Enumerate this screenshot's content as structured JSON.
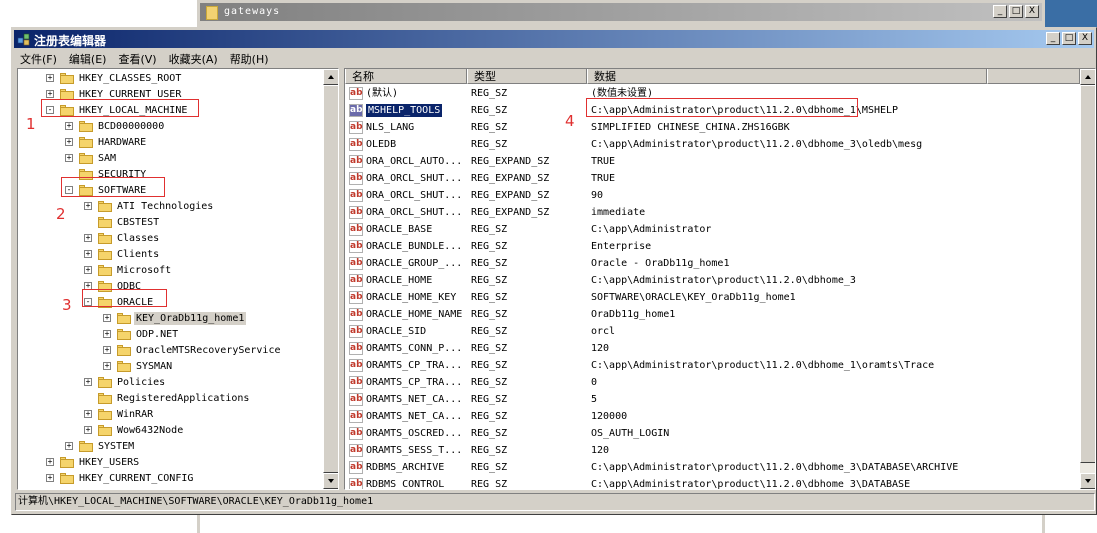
{
  "background_window": {
    "title": "gateways",
    "buttons": [
      "_",
      "□",
      "X"
    ]
  },
  "window": {
    "title": "注册表编辑器",
    "buttons": [
      "_",
      "□",
      "X"
    ]
  },
  "menu": [
    "文件(F)",
    "编辑(E)",
    "查看(V)",
    "收藏夹(A)",
    "帮助(H)"
  ],
  "tree": [
    {
      "label": "HKEY_CLASSES_ROOT",
      "expander": "+"
    },
    {
      "label": "HKEY_CURRENT_USER",
      "expander": "+"
    },
    {
      "label": "HKEY_LOCAL_MACHINE",
      "expander": "-"
    },
    {
      "label": "BCD00000000",
      "expander": "+"
    },
    {
      "label": "HARDWARE",
      "expander": "+"
    },
    {
      "label": "SAM",
      "expander": "+"
    },
    {
      "label": "SECURITY",
      "expander": ""
    },
    {
      "label": "SOFTWARE",
      "expander": "-"
    },
    {
      "label": "ATI Technologies",
      "expander": "+"
    },
    {
      "label": "CBSTEST",
      "expander": ""
    },
    {
      "label": "Classes",
      "expander": "+"
    },
    {
      "label": "Clients",
      "expander": "+"
    },
    {
      "label": "Microsoft",
      "expander": "+"
    },
    {
      "label": "ODBC",
      "expander": "+"
    },
    {
      "label": "ORACLE",
      "expander": "-"
    },
    {
      "label": "KEY_OraDb11g_home1",
      "expander": "+",
      "selected": true
    },
    {
      "label": "ODP.NET",
      "expander": "+"
    },
    {
      "label": "OracleMTSRecoveryService",
      "expander": "+"
    },
    {
      "label": "SYSMAN",
      "expander": "+"
    },
    {
      "label": "Policies",
      "expander": "+"
    },
    {
      "label": "RegisteredApplications",
      "expander": ""
    },
    {
      "label": "WinRAR",
      "expander": "+"
    },
    {
      "label": "Wow6432Node",
      "expander": "+"
    },
    {
      "label": "SYSTEM",
      "expander": "+"
    },
    {
      "label": "HKEY_USERS",
      "expander": "+"
    },
    {
      "label": "HKEY_CURRENT_CONFIG",
      "expander": "+"
    }
  ],
  "columns": {
    "name": "名称",
    "type": "类型",
    "data": "数据"
  },
  "values": [
    {
      "name": "(默认)",
      "type": "REG_SZ",
      "data": "(数值未设置)"
    },
    {
      "name": "MSHELP_TOOLS",
      "type": "REG_SZ",
      "data": "C:\\app\\Administrator\\product\\11.2.0\\dbhome_1\\MSHELP",
      "selected": true
    },
    {
      "name": "NLS_LANG",
      "type": "REG_SZ",
      "data": "SIMPLIFIED CHINESE_CHINA.ZHS16GBK"
    },
    {
      "name": "OLEDB",
      "type": "REG_SZ",
      "data": "C:\\app\\Administrator\\product\\11.2.0\\dbhome_3\\oledb\\mesg"
    },
    {
      "name": "ORA_ORCL_AUTO...",
      "type": "REG_EXPAND_SZ",
      "data": "TRUE"
    },
    {
      "name": "ORA_ORCL_SHUT...",
      "type": "REG_EXPAND_SZ",
      "data": "TRUE"
    },
    {
      "name": "ORA_ORCL_SHUT...",
      "type": "REG_EXPAND_SZ",
      "data": "90"
    },
    {
      "name": "ORA_ORCL_SHUT...",
      "type": "REG_EXPAND_SZ",
      "data": "immediate"
    },
    {
      "name": "ORACLE_BASE",
      "type": "REG_SZ",
      "data": "C:\\app\\Administrator"
    },
    {
      "name": "ORACLE_BUNDLE...",
      "type": "REG_SZ",
      "data": "Enterprise"
    },
    {
      "name": "ORACLE_GROUP_...",
      "type": "REG_SZ",
      "data": "Oracle - OraDb11g_home1"
    },
    {
      "name": "ORACLE_HOME",
      "type": "REG_SZ",
      "data": "C:\\app\\Administrator\\product\\11.2.0\\dbhome_3"
    },
    {
      "name": "ORACLE_HOME_KEY",
      "type": "REG_SZ",
      "data": "SOFTWARE\\ORACLE\\KEY_OraDb11g_home1"
    },
    {
      "name": "ORACLE_HOME_NAME",
      "type": "REG_SZ",
      "data": "OraDb11g_home1"
    },
    {
      "name": "ORACLE_SID",
      "type": "REG_SZ",
      "data": "orcl"
    },
    {
      "name": "ORAMTS_CONN_P...",
      "type": "REG_SZ",
      "data": "120"
    },
    {
      "name": "ORAMTS_CP_TRA...",
      "type": "REG_SZ",
      "data": "C:\\app\\Administrator\\product\\11.2.0\\dbhome_1\\oramts\\Trace"
    },
    {
      "name": "ORAMTS_CP_TRA...",
      "type": "REG_SZ",
      "data": "0"
    },
    {
      "name": "ORAMTS_NET_CA...",
      "type": "REG_SZ",
      "data": "5"
    },
    {
      "name": "ORAMTS_NET_CA...",
      "type": "REG_SZ",
      "data": "120000"
    },
    {
      "name": "ORAMTS_OSCRED...",
      "type": "REG_SZ",
      "data": "OS_AUTH_LOGIN"
    },
    {
      "name": "ORAMTS_SESS_T...",
      "type": "REG_SZ",
      "data": "120"
    },
    {
      "name": "RDBMS_ARCHIVE",
      "type": "REG_SZ",
      "data": "C:\\app\\Administrator\\product\\11.2.0\\dbhome_3\\DATABASE\\ARCHIVE"
    },
    {
      "name": "RDBMS_CONTROL",
      "type": "REG_SZ",
      "data": "C:\\app\\Administrator\\product\\11.2.0\\dbhome_3\\DATABASE"
    }
  ],
  "value_icon_text": "ab",
  "status": "计算机\\HKEY_LOCAL_MACHINE\\SOFTWARE\\ORACLE\\KEY_OraDb11g_home1",
  "annotations": [
    "1",
    "2",
    "3",
    "4"
  ],
  "colors": {
    "annotation": "#e03030",
    "titlebar": "#0a246a",
    "selection": "#0a246a"
  }
}
